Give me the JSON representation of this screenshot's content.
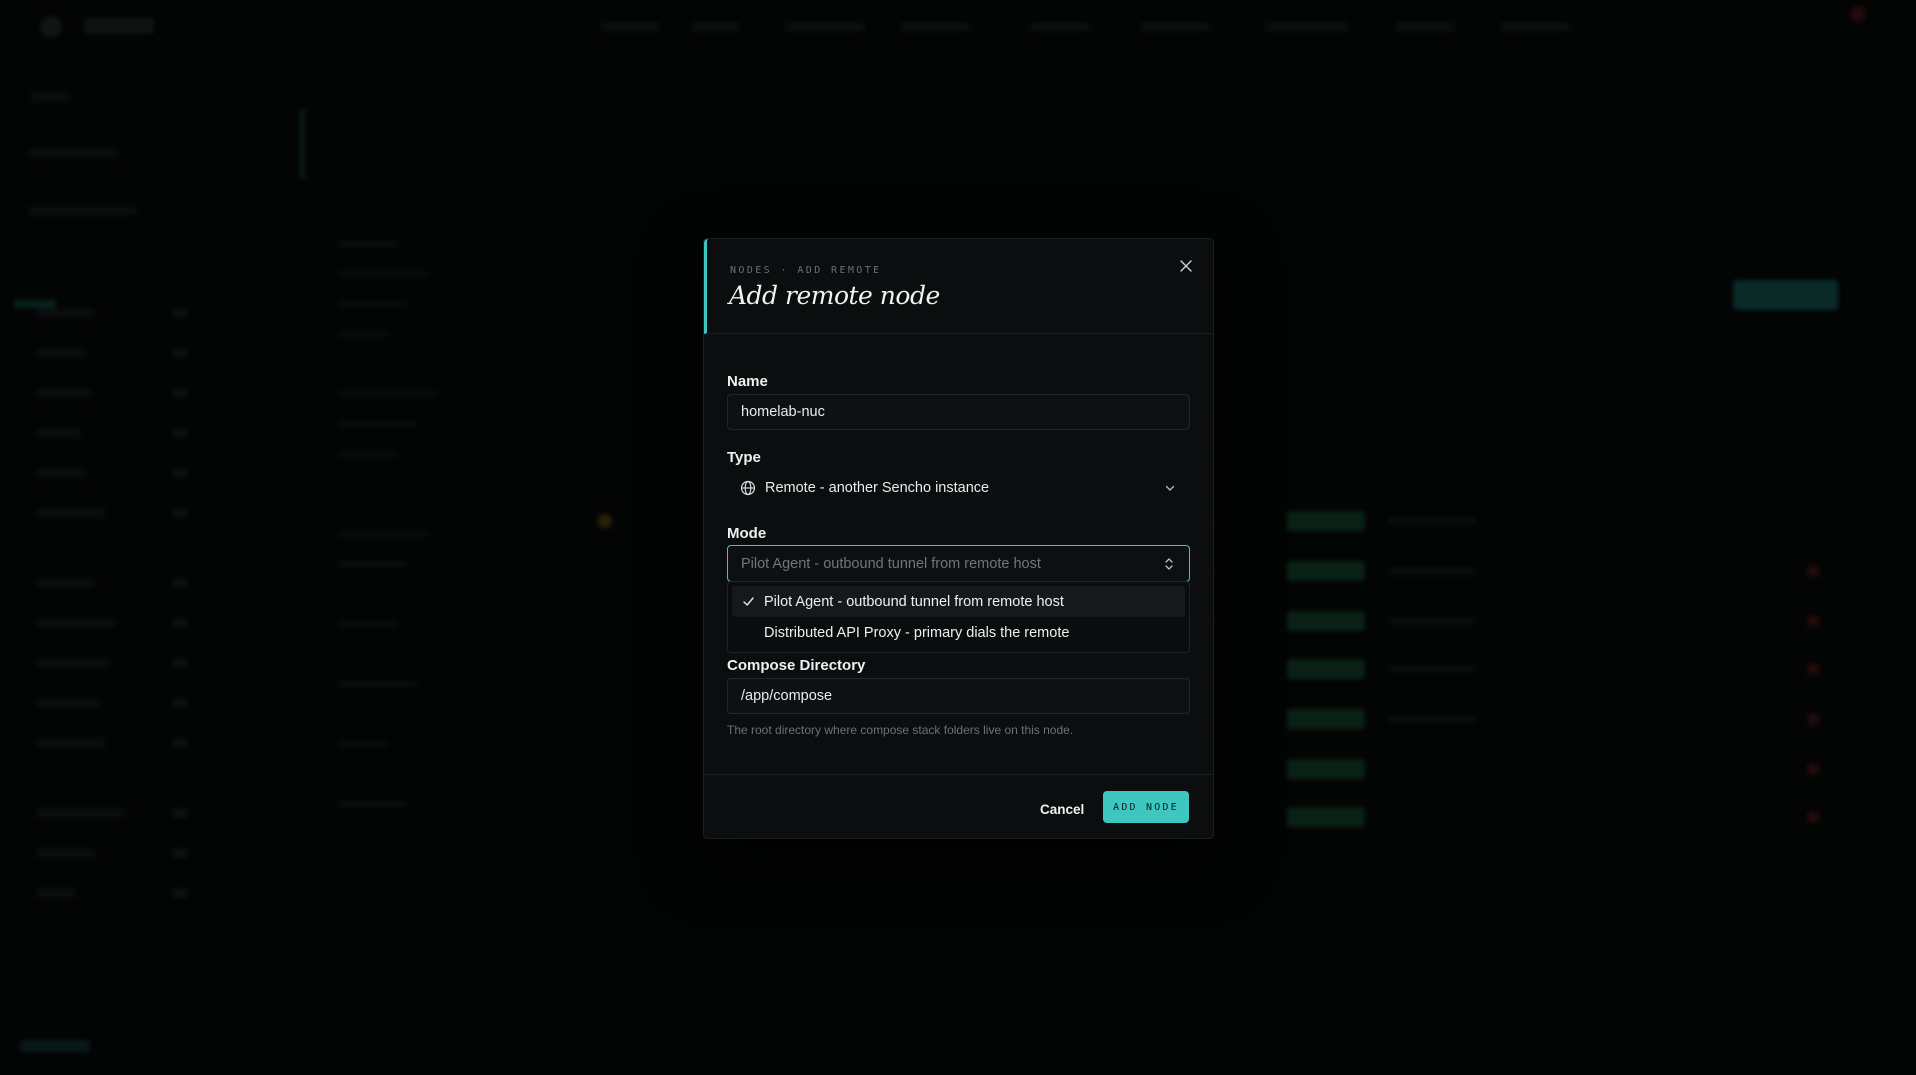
{
  "modal": {
    "eyebrow": "NODES · ADD REMOTE",
    "title": "Add remote node",
    "close_icon": "close-icon"
  },
  "form": {
    "name": {
      "label": "Name",
      "value": "homelab-nuc"
    },
    "type": {
      "label": "Type",
      "icon": "globe-icon",
      "value": "Remote - another Sencho instance"
    },
    "mode": {
      "label": "Mode",
      "placeholder": "Pilot Agent - outbound tunnel from remote host",
      "options": [
        {
          "label": "Pilot Agent - outbound tunnel from remote host",
          "selected": true
        },
        {
          "label": "Distributed API Proxy - primary dials the remote",
          "selected": false
        }
      ]
    },
    "compose_directory": {
      "label": "Compose Directory",
      "value": "/app/compose",
      "help": "The root directory where compose stack folders live on this node."
    }
  },
  "footer": {
    "cancel_label": "Cancel",
    "submit_label": "ADD NODE"
  },
  "colors": {
    "accent": "#3ec7c0",
    "background": "#030404",
    "modal_bg": "#0b0d0e"
  }
}
